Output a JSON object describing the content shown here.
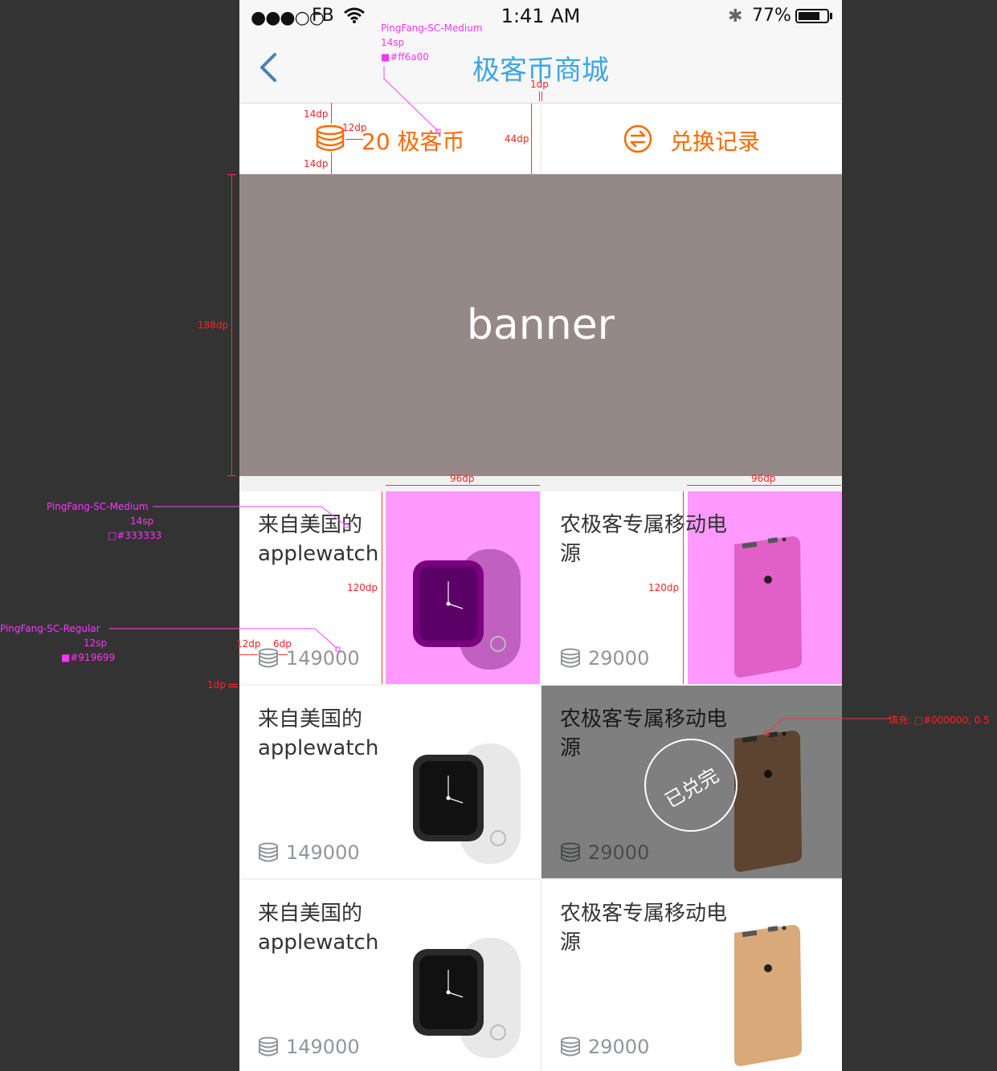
{
  "status_bar": {
    "signal": "●●●○○",
    "carrier": "FB",
    "time": "1:41 AM",
    "bluetooth": "✱",
    "battery_pct": "77%",
    "battery_level": 0.77
  },
  "nav": {
    "back_icon": "chevron-left-icon",
    "title": "极客币商城",
    "title_color": "#3ea6e2"
  },
  "coins": {
    "balance": "20 极客币",
    "history_label": "兑换记录",
    "accent": "#ff6a00"
  },
  "banner": {
    "text": "banner"
  },
  "products": [
    {
      "name": "来自美国的applewatch",
      "price": "149000",
      "image": "apple-watch",
      "highlight": true,
      "sold_out": false
    },
    {
      "name": "农极客专属移动电源",
      "price": "29000",
      "image": "power-bank-pink",
      "highlight": true,
      "sold_out": false
    },
    {
      "name": "来自美国的applewatch",
      "price": "149000",
      "image": "apple-watch",
      "highlight": false,
      "sold_out": false
    },
    {
      "name": "农极客专属移动电源",
      "price": "29000",
      "image": "power-bank-brown",
      "highlight": false,
      "sold_out": true,
      "stamp": "已兑完"
    },
    {
      "name": "来自美国的applewatch",
      "price": "149000",
      "image": "apple-watch",
      "highlight": false,
      "sold_out": false
    },
    {
      "name": "农极客专属移动电源",
      "price": "29000",
      "image": "power-bank-gold",
      "highlight": false,
      "sold_out": false
    }
  ],
  "annotations": {
    "title_font": "PingFang-SC-Medium",
    "title_size": "14sp",
    "title_color": "■#ff6a00",
    "dim_1dp": "1dp",
    "dim_14dp": "14dp",
    "dim_12dp": "12dp",
    "dim_44dp": "44dp",
    "dim_188dp": "188dp",
    "dim_96dp": "96dp",
    "dim_120dp": "120dp",
    "dim_6dp": "6dp",
    "name_font": "PingFang-SC-Medium",
    "name_size": "14sp",
    "name_color": "□#333333",
    "price_font": "PingFang-SC-Regular",
    "price_size": "12sp",
    "price_color": "■#919699",
    "fill_note": "填充: □#000000, 0.5"
  }
}
